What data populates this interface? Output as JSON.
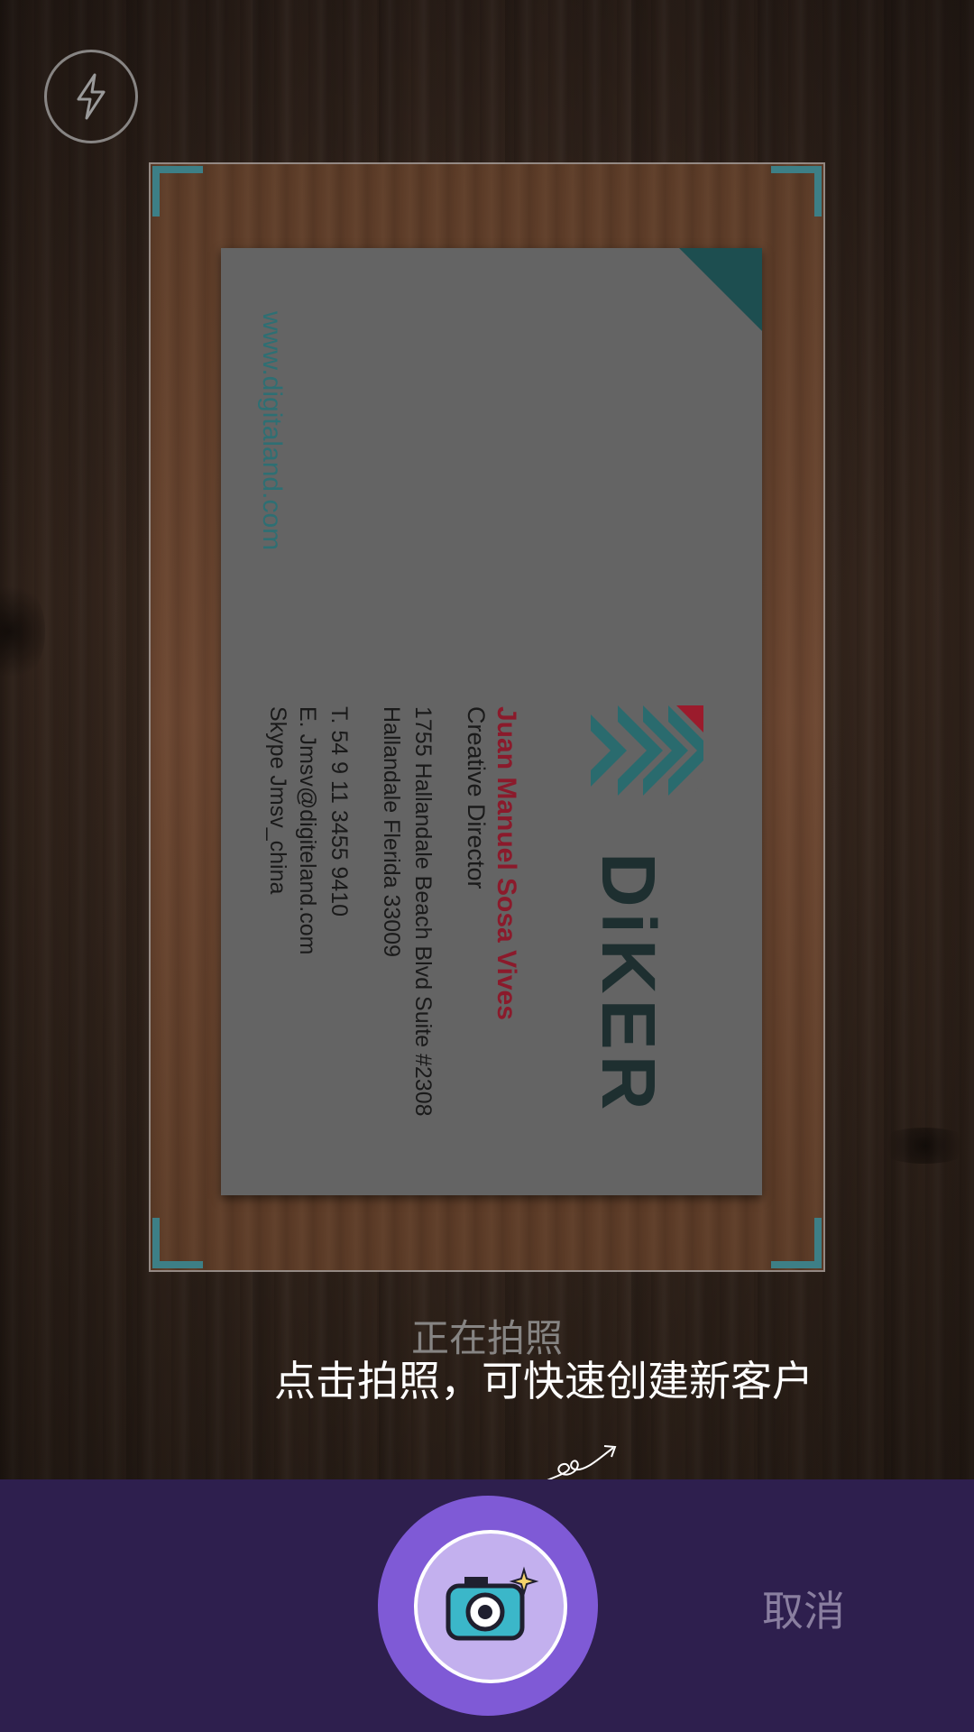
{
  "flash": {
    "icon": "flash-icon"
  },
  "card": {
    "website": "www.digitaland.com",
    "name": "Juan Manuel Sosa Vives",
    "title": "Creative Director",
    "address1": "1755 Hallandale Beach Blvd Suite #2308",
    "address2": "Hallandale Flerida 33009",
    "phone": "T. 54 9 11 3455 9410",
    "email": "E. Jmsv@digiteland.com",
    "skype": "Skype Jmsv_china",
    "brand": "DiKER"
  },
  "status": {
    "capturing": "正在拍照",
    "hint": "点击拍照，可快速创建新客户"
  },
  "bottom_bar": {
    "shutter_icon": "camera-icon",
    "cancel_label": "取消"
  },
  "colors": {
    "accent_teal": "#3d7f86",
    "bar_bg": "#2e1f4e",
    "shutter_outer": "#7f5ad6",
    "shutter_inner": "#c3b0ee"
  }
}
